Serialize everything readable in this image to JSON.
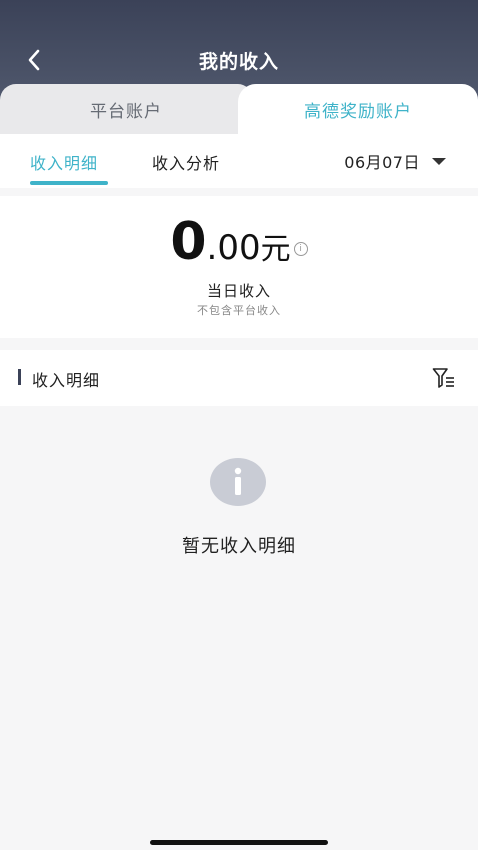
{
  "header": {
    "title": "我的收入",
    "back_icon": "chevron-left-icon"
  },
  "account_tabs": [
    {
      "label": "平台账户",
      "active": false
    },
    {
      "label": "高德奖励账户",
      "active": true
    }
  ],
  "sub_tabs": [
    {
      "label": "收入明细",
      "active": true
    },
    {
      "label": "收入分析",
      "active": false
    }
  ],
  "date_selector": {
    "value": "06月07日",
    "icon": "caret-down-icon"
  },
  "summary": {
    "amount_int": "0",
    "amount_dec": ".00",
    "unit": "元",
    "info_glyph": "i",
    "label": "当日收入",
    "note": "不包含平台收入"
  },
  "detail_section": {
    "title": "收入明细",
    "filter_icon": "filter-icon"
  },
  "empty_state": {
    "icon": "info-icon",
    "glyph": "i",
    "text": "暂无收入明细"
  },
  "colors": {
    "accent": "#3fb3c9",
    "header_bg": "#4a5267",
    "text_primary": "#222222",
    "page_bg": "#f6f6f7"
  }
}
